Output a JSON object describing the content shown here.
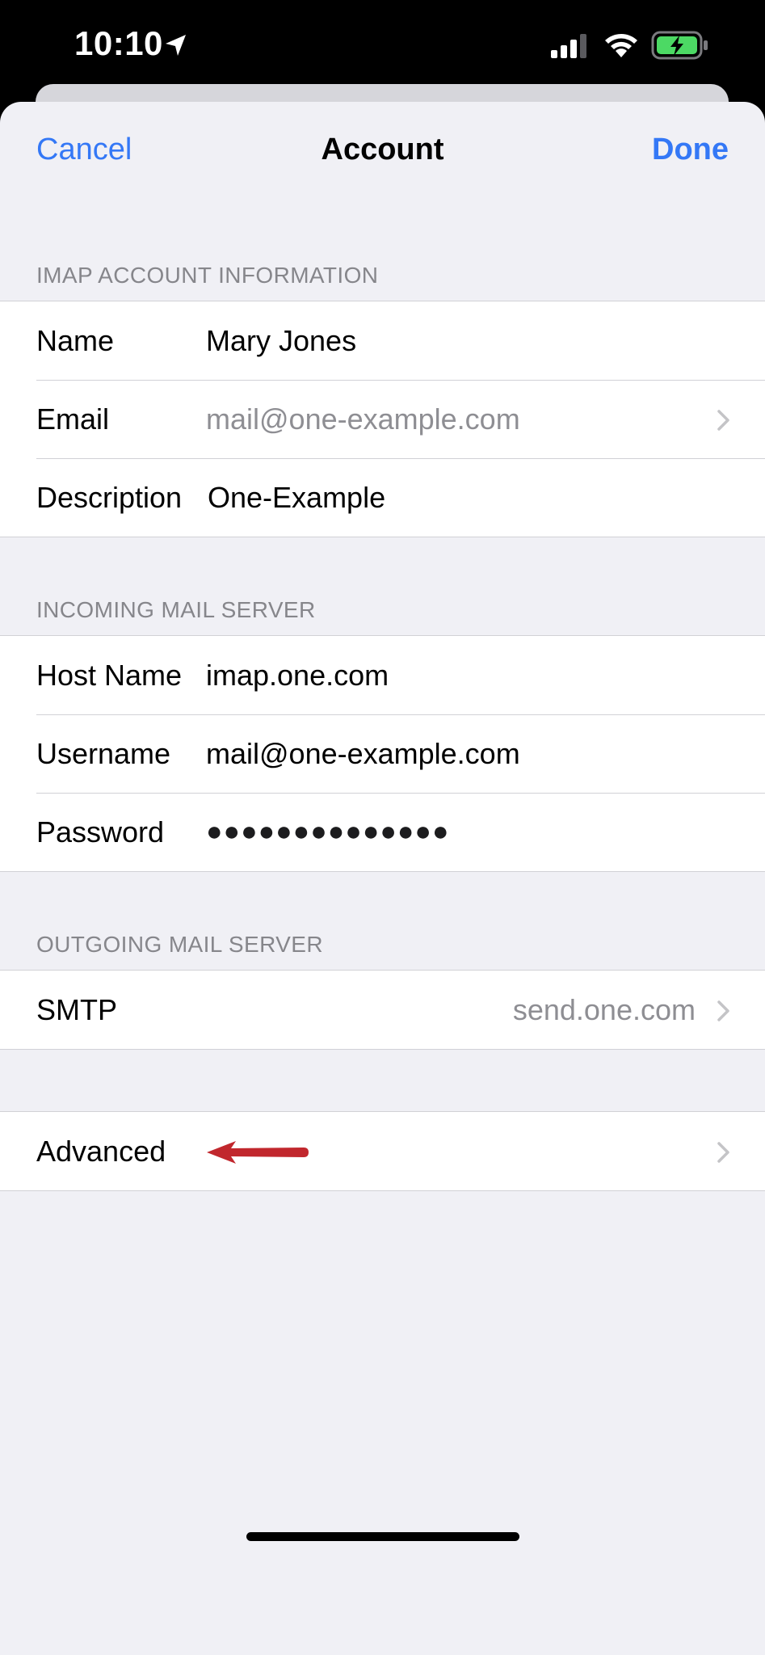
{
  "status_bar": {
    "time": "10:10",
    "icons": [
      "location-arrow-icon",
      "cellular-signal-icon",
      "wifi-icon",
      "battery-charging-icon"
    ],
    "battery_color": "#4cd964"
  },
  "nav": {
    "cancel_label": "Cancel",
    "title": "Account",
    "done_label": "Done",
    "accent_color": "#3478f6"
  },
  "imap_section": {
    "header": "IMAP ACCOUNT INFORMATION",
    "rows": [
      {
        "label": "Name",
        "value": "Mary Jones"
      },
      {
        "label": "Email",
        "value": "mail@one-example.com"
      },
      {
        "label": "Description",
        "value": "One-Example"
      }
    ]
  },
  "incoming_section": {
    "header": "INCOMING MAIL SERVER",
    "rows": [
      {
        "label": "Host Name",
        "value": "imap.one.com"
      },
      {
        "label": "Username",
        "value": "mail@one-example.com"
      },
      {
        "label": "Password",
        "value": "●●●●●●●●●●●●●●"
      }
    ]
  },
  "outgoing_section": {
    "header": "OUTGOING MAIL SERVER",
    "rows": [
      {
        "label": "SMTP",
        "value": "send.one.com"
      }
    ]
  },
  "advanced_section": {
    "rows": [
      {
        "label": "Advanced"
      }
    ],
    "annotation_arrow_color": "#c1272d"
  }
}
